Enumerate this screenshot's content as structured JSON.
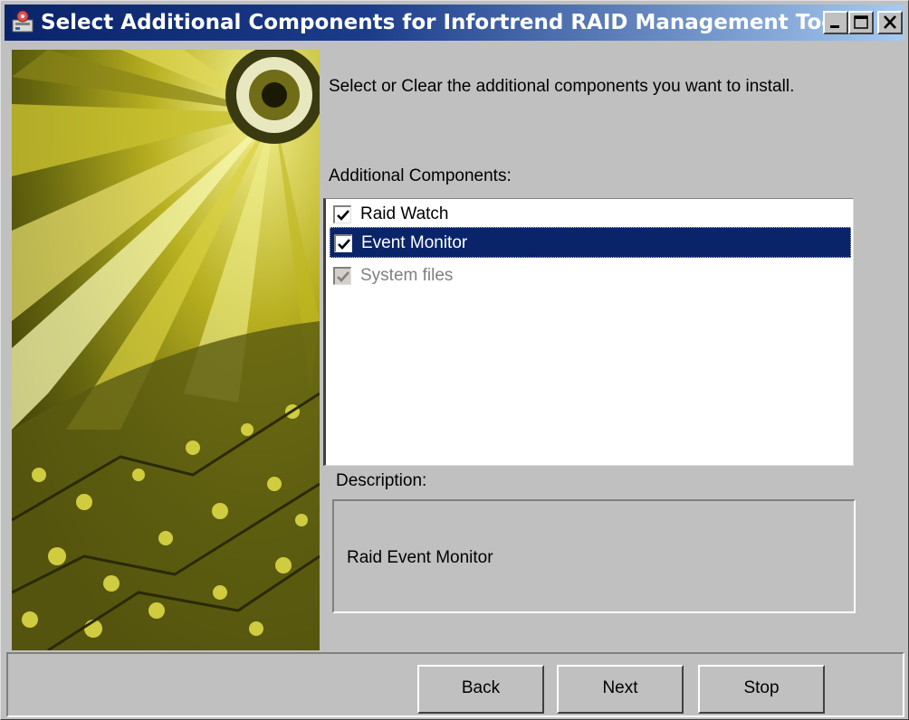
{
  "window": {
    "title": "Select Additional Components for Infortrend RAID Management Tool",
    "app_icon": "installer-icon",
    "controls": [
      "minimize-icon",
      "maximize-icon",
      "close-icon"
    ]
  },
  "instruction": "Select or Clear the additional components you want to install.",
  "components": {
    "label": "Additional Components:",
    "items": [
      {
        "label": "Raid Watch",
        "checked": true,
        "selected": false,
        "enabled": true
      },
      {
        "label": "Event Monitor",
        "checked": true,
        "selected": true,
        "enabled": true
      },
      {
        "label": "System files",
        "checked": true,
        "selected": false,
        "enabled": false
      }
    ]
  },
  "description": {
    "label": "Description:",
    "text": "Raid Event Monitor"
  },
  "buttons": {
    "back": "Back",
    "next": "Next",
    "stop": "Stop"
  },
  "colors": {
    "titlebar_start": "#0a246a",
    "titlebar_end": "#a6caf0",
    "selection": "#0a246a",
    "face": "#c0c0c0"
  }
}
